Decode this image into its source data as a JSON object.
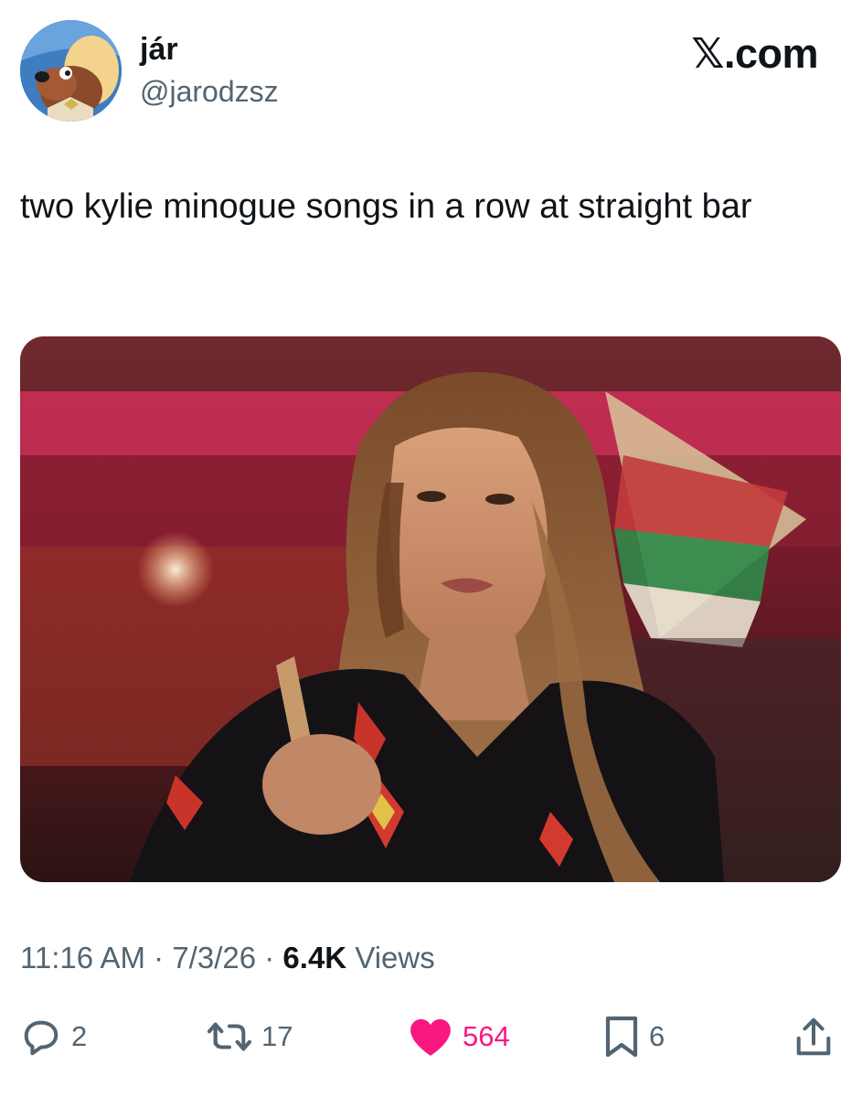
{
  "author": {
    "display_name": "jár",
    "handle": "@jarodzsz",
    "avatar_icon": "cartoon-dog-avatar"
  },
  "brand": {
    "label": "𝕏.com"
  },
  "tweet": {
    "text": "two kylie minogue songs in a row at straight bar"
  },
  "media": {
    "type": "photo"
  },
  "meta": {
    "time": "11:16 AM",
    "separator": "·",
    "date": "7/3/26",
    "views_count": "6.4K",
    "views_label": "Views"
  },
  "actions": {
    "replies": {
      "icon": "reply-icon",
      "count": "2"
    },
    "retweets": {
      "icon": "retweet-icon",
      "count": "17"
    },
    "likes": {
      "icon": "heart-icon",
      "count": "564",
      "color": "#f91880"
    },
    "bookmarks": {
      "icon": "bookmark-icon",
      "count": "6"
    },
    "share": {
      "icon": "share-icon"
    }
  },
  "colors": {
    "text_primary": "#0f1419",
    "text_secondary": "#536471",
    "like": "#f91880"
  }
}
